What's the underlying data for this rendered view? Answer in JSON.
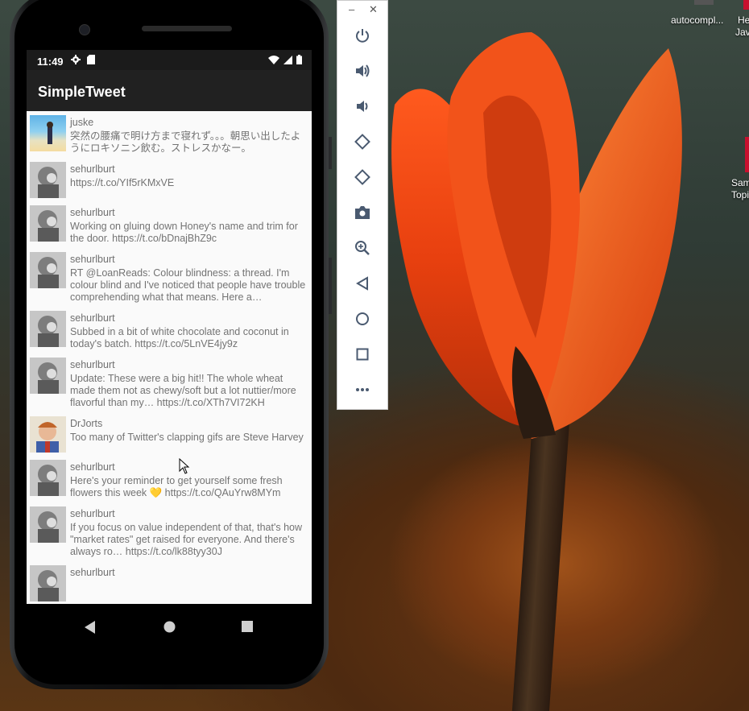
{
  "desktop": {
    "icons": [
      {
        "label": "autocompl...",
        "name": "desktop-icon-autocomplete"
      },
      {
        "label": "He",
        "name": "desktop-icon-he"
      },
      {
        "label": "Jav",
        "name": "desktop-icon-jav"
      },
      {
        "label": "Sam",
        "name": "desktop-icon-sam"
      },
      {
        "label": "Topi",
        "name": "desktop-icon-topi"
      }
    ]
  },
  "phone": {
    "status": {
      "time": "11:49",
      "left_icons": [
        "gear-icon",
        "sd-card-icon"
      ],
      "right_icons": [
        "wifi-icon",
        "signal-icon",
        "battery-icon"
      ]
    },
    "app": {
      "title": "SimpleTweet",
      "bar_color": "#212121"
    },
    "tweets": [
      {
        "user": "juske",
        "avatar": "beach",
        "text": "突然の腰痛で明け方まで寝れず。。。朝思い出したようにロキソニン飲む。ストレスかなー。"
      },
      {
        "user": "sehurlburt",
        "avatar": "gray",
        "text": "https://t.co/YIf5rKMxVE"
      },
      {
        "user": "sehurlburt",
        "avatar": "gray",
        "text": "Working on gluing down Honey's name and trim for the door. https://t.co/bDnajBhZ9c"
      },
      {
        "user": "sehurlburt",
        "avatar": "gray",
        "text": "RT @LoanReads: Colour blindness: a thread. I'm colour blind and I've noticed that people have trouble comprehending what that means. Here a…"
      },
      {
        "user": "sehurlburt",
        "avatar": "gray",
        "text": "Subbed in a bit of white chocolate and coconut in today's batch. https://t.co/5LnVE4jy9z"
      },
      {
        "user": "sehurlburt",
        "avatar": "gray",
        "text": "Update: These were a big hit!! The whole wheat made them not as chewy/soft but a lot nuttier/more flavorful than my… https://t.co/XTh7VI72KH"
      },
      {
        "user": "DrJorts",
        "avatar": "cartoon",
        "text": "Too many of Twitter's clapping gifs are Steve Harvey"
      },
      {
        "user": "sehurlburt",
        "avatar": "gray",
        "text": "Here's your reminder to get yourself some fresh flowers this week 💛 https://t.co/QAuYrw8MYm"
      },
      {
        "user": "sehurlburt",
        "avatar": "gray",
        "text": "If you focus on value independent of that, that's how \"market rates\" get raised for everyone. And there's always ro… https://t.co/lk88tyy30J"
      },
      {
        "user": "sehurlburt",
        "avatar": "gray",
        "text": ""
      }
    ],
    "nav": [
      "back-nav",
      "home-nav",
      "recents-nav"
    ]
  },
  "emulator_toolbar": {
    "buttons": [
      "power",
      "volume-up",
      "volume-down",
      "rotate-left",
      "rotate-right",
      "screenshot",
      "zoom",
      "back",
      "home",
      "overview",
      "more"
    ]
  }
}
